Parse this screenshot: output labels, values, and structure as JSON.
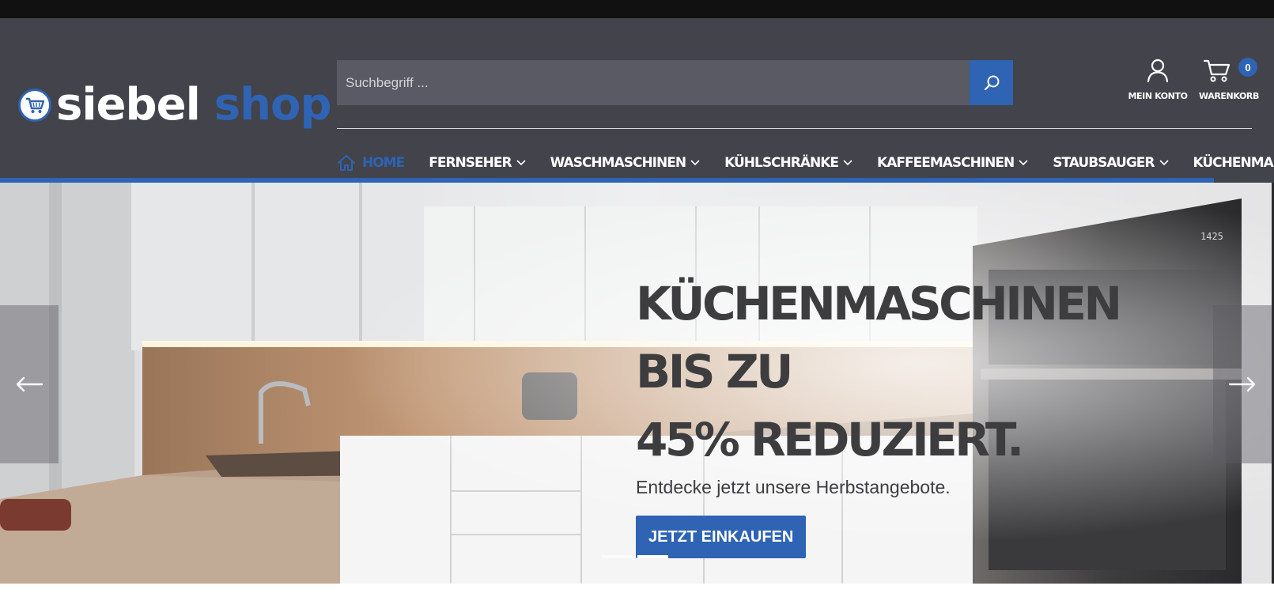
{
  "brand": {
    "name_part1": "siebel",
    "name_part2": "shop",
    "accent_color": "#2f63b3",
    "header_bg": "#42434b"
  },
  "search": {
    "placeholder": "Suchbegriff ...",
    "value": "",
    "button_icon": "search-icon"
  },
  "account": {
    "label": "MEIN KONTO",
    "icon": "user-icon"
  },
  "cart": {
    "label": "WARENKORB",
    "icon": "cart-icon",
    "count": "0"
  },
  "nav": {
    "items": [
      {
        "label": "Home",
        "active": true,
        "has_dropdown": false,
        "icon": "home-icon"
      },
      {
        "label": "Fernseher",
        "has_dropdown": true
      },
      {
        "label": "Waschmaschinen",
        "has_dropdown": true
      },
      {
        "label": "Kühlschränke",
        "has_dropdown": true
      },
      {
        "label": "Kaffeemaschinen",
        "has_dropdown": true
      },
      {
        "label": "Staubsauger",
        "has_dropdown": true
      },
      {
        "label": "Küchenmaschinen",
        "has_dropdown": false
      }
    ]
  },
  "hero": {
    "title_line1": "Küchenmaschinen bis zu",
    "title_line2": "45% reduziert.",
    "subtitle": "Entdecke jetzt unsere Herbstangebote.",
    "cta_label": "JETZT EINKAUFEN",
    "slides": 2,
    "active_slide": 2,
    "oven_display": "1425"
  }
}
